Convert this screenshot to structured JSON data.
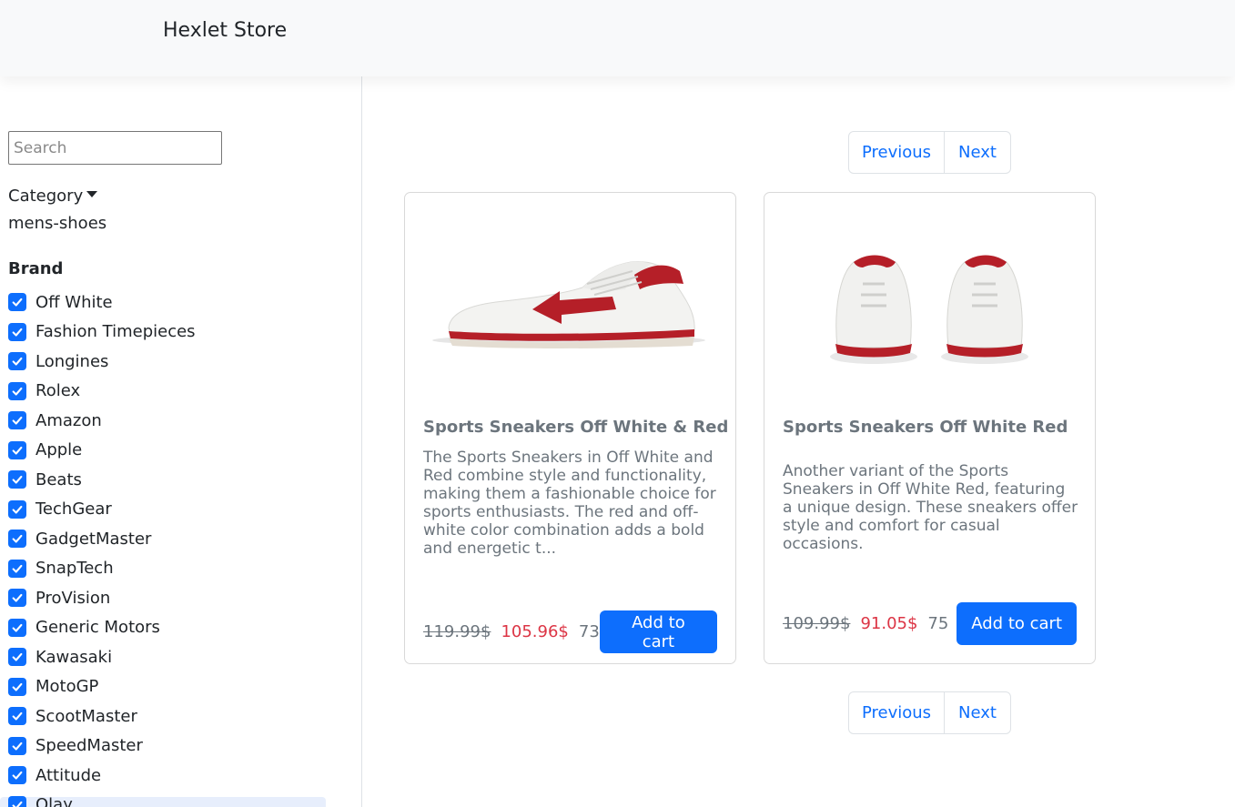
{
  "header": {
    "brand": "Hexlet Store"
  },
  "sidebar": {
    "search_placeholder": "Search",
    "category_label": "Category",
    "category_value": "mens-shoes",
    "brand_heading": "Brand",
    "brands": [
      {
        "label": "Off White",
        "checked": true
      },
      {
        "label": "Fashion Timepieces",
        "checked": true
      },
      {
        "label": "Longines",
        "checked": true
      },
      {
        "label": "Rolex",
        "checked": true
      },
      {
        "label": "Amazon",
        "checked": true
      },
      {
        "label": "Apple",
        "checked": true
      },
      {
        "label": "Beats",
        "checked": true
      },
      {
        "label": "TechGear",
        "checked": true
      },
      {
        "label": "GadgetMaster",
        "checked": true
      },
      {
        "label": "SnapTech",
        "checked": true
      },
      {
        "label": "ProVision",
        "checked": true
      },
      {
        "label": "Generic Motors",
        "checked": true
      },
      {
        "label": "Kawasaki",
        "checked": true
      },
      {
        "label": "MotoGP",
        "checked": true
      },
      {
        "label": "ScootMaster",
        "checked": true
      },
      {
        "label": "SpeedMaster",
        "checked": true
      },
      {
        "label": "Attitude",
        "checked": true
      },
      {
        "label": "Olay",
        "checked": true
      }
    ]
  },
  "pagination": {
    "previous": "Previous",
    "next": "Next"
  },
  "products": [
    {
      "title": "Sports Sneakers Off White & Red",
      "description": "The Sports Sneakers in Off White and Red combine style and functionality, making them a fashionable choice for sports enthusiasts. The red and off-white color combination adds a bold and energetic t...",
      "old_price": "119.99$",
      "new_price": "105.96$",
      "stock": "73",
      "button": "Add to cart"
    },
    {
      "title": "Sports Sneakers Off White Red",
      "description": "Another variant of the Sports Sneakers in Off White Red, featuring a unique design. These sneakers offer style and comfort for casual occasions.",
      "old_price": "109.99$",
      "new_price": "91.05$",
      "stock": "75",
      "button": "Add to cart"
    }
  ],
  "colors": {
    "primary": "#0d6efd",
    "price_red": "#dc3545",
    "muted": "#6c757d",
    "navbar_bg": "#f8f9fa",
    "shoe_red": "#c0212a"
  }
}
